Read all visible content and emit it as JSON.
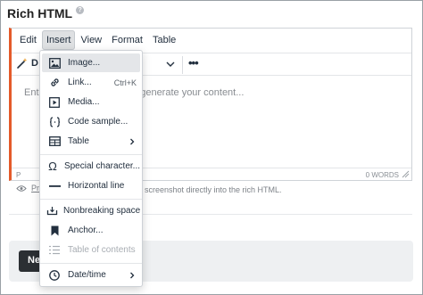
{
  "field": {
    "title": "Rich HTML",
    "help_glyph": "?"
  },
  "menubar": {
    "items": [
      "Edit",
      "Insert",
      "View",
      "Format",
      "Table"
    ],
    "active": "Insert"
  },
  "toolbar": {
    "ai_label": "D",
    "more": "•••"
  },
  "editor": {
    "placeholder": "Ente…  lick Draft with AI to generate your content...",
    "status_path": "P",
    "word_count": "0 WORDS"
  },
  "below": {
    "preview_link": "Pr",
    "hint": "screenshot directly into the rich HTML."
  },
  "footer": {
    "next_label": "Ne"
  },
  "insert_menu": {
    "image": "Image...",
    "link": "Link...",
    "link_shortcut": "Ctrl+K",
    "media": "Media...",
    "code_sample": "Code sample...",
    "table": "Table",
    "special_character": "Special character...",
    "horizontal_line": "Horizontal line",
    "nonbreaking_space": "Nonbreaking space",
    "anchor": "Anchor...",
    "table_of_contents": "Table of contents",
    "datetime": "Date/time"
  },
  "colors": {
    "accent_border": "#e45a2a",
    "next_button": "#2b2f33",
    "menu_hover": "#e4e6e9"
  }
}
